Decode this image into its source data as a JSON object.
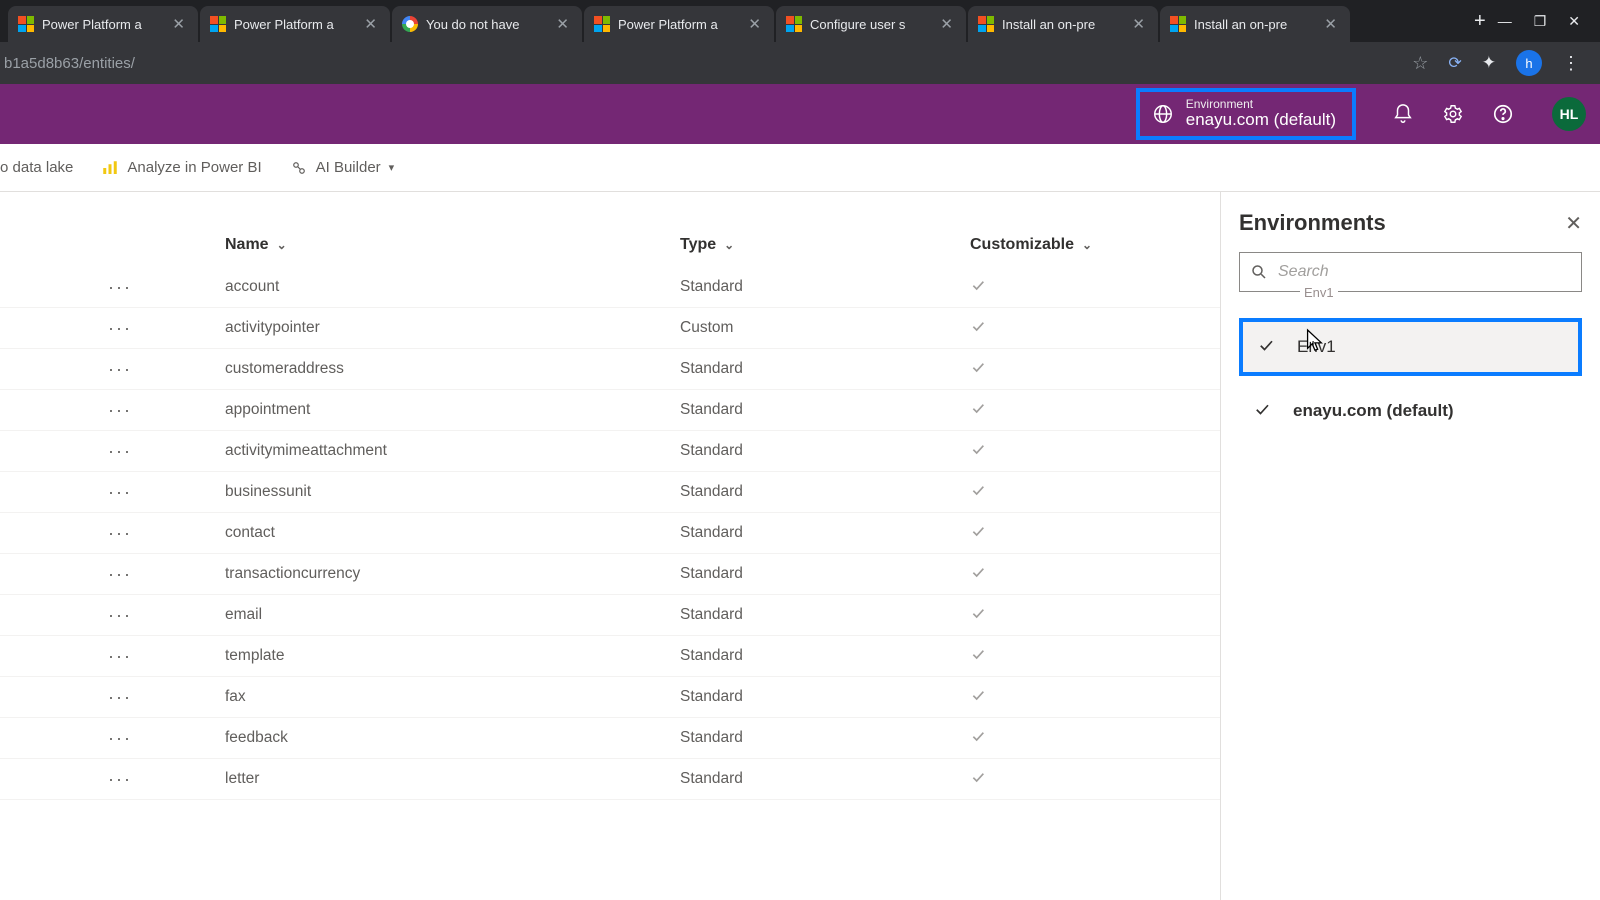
{
  "browser": {
    "tabs": [
      {
        "title": "Power Platform a",
        "icon": "ppa"
      },
      {
        "title": "Power Platform a",
        "icon": "ppa"
      },
      {
        "title": "You do not have",
        "icon": "google"
      },
      {
        "title": "Power Platform a",
        "icon": "ppa"
      },
      {
        "title": "Configure user s",
        "icon": "ppa"
      },
      {
        "title": "Install an on-pre",
        "icon": "ppa"
      },
      {
        "title": "Install an on-pre",
        "icon": "ppa"
      }
    ],
    "url": "b1a5d8b63/entities/",
    "profile_initial": "h"
  },
  "header": {
    "env_label": "Environment",
    "env_value": "enayu.com (default)",
    "user_initials": "HL"
  },
  "command_bar": {
    "datalake": "o data lake",
    "powerbi": "Analyze in Power BI",
    "aibuilder": "AI Builder"
  },
  "columns": {
    "name": "Name",
    "type": "Type",
    "customizable": "Customizable"
  },
  "entities": [
    {
      "name": "account",
      "type": "Standard",
      "customizable": true
    },
    {
      "name": "activitypointer",
      "type": "Custom",
      "customizable": true
    },
    {
      "name": "customeraddress",
      "type": "Standard",
      "customizable": true
    },
    {
      "name": "appointment",
      "type": "Standard",
      "customizable": true
    },
    {
      "name": "activitymimeattachment",
      "type": "Standard",
      "customizable": true
    },
    {
      "name": "businessunit",
      "type": "Standard",
      "customizable": true
    },
    {
      "name": "contact",
      "type": "Standard",
      "customizable": true
    },
    {
      "name": "transactioncurrency",
      "type": "Standard",
      "customizable": true
    },
    {
      "name": "email",
      "type": "Standard",
      "customizable": true
    },
    {
      "name": "template",
      "type": "Standard",
      "customizable": true
    },
    {
      "name": "fax",
      "type": "Standard",
      "customizable": true
    },
    {
      "name": "feedback",
      "type": "Standard",
      "customizable": true
    },
    {
      "name": "letter",
      "type": "Standard",
      "customizable": true
    }
  ],
  "panel": {
    "title": "Environments",
    "search_placeholder": "Search",
    "search_hint": "Env1",
    "items": [
      {
        "name": "Env1",
        "selected": true
      },
      {
        "name": "enayu.com (default)",
        "selected": false
      }
    ]
  }
}
